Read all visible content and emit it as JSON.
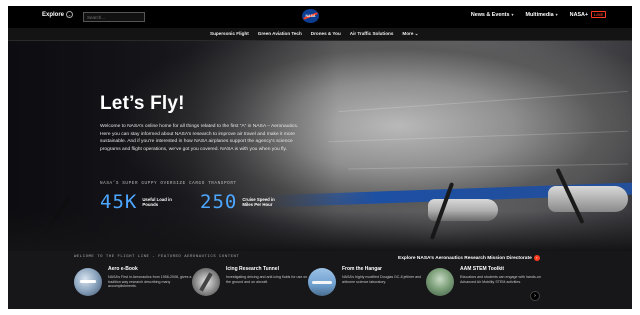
{
  "topnav": {
    "explore_label": "Explore",
    "search_placeholder": "Search...",
    "logo_text": "NASA",
    "right_items": [
      {
        "label": "News & Events",
        "has_caret": true
      },
      {
        "label": "Multimedia",
        "has_caret": true
      },
      {
        "label": "NASA+",
        "badge": "LIVE"
      }
    ]
  },
  "subnav": {
    "items": [
      "Supersonic Flight",
      "Green Aviation Tech",
      "Drones & You",
      "Air Traffic Solutions",
      "More"
    ]
  },
  "hero": {
    "title": "Let’s Fly!",
    "intro": "Welcome to NASA’s online home for all things related to the first “A” in NASA – Aeronautics. Here you can stay informed about NASA’s research to improve air travel and make it more sustainable. And if you’re interested in how NASA airplanes support the agency’s science programs and flight operations, we’ve got you covered. NASA is with you when you fly.",
    "eyebrow": "NASA’S SUPER GUPPY OVERSIZE CARGO TRANSPORT",
    "stats": [
      {
        "value": "45K",
        "label": "Useful Load in Pounds"
      },
      {
        "value": "250",
        "label": "Cruise Speed in Miles Per Hour"
      }
    ]
  },
  "bottom": {
    "eyebrow": "WELCOME TO THE FLIGHT LINE – FEATURED AERONAUTICS CONTENT",
    "link_label": "Explore NASA’s Aeronautics Research Mission Directorate",
    "cards": [
      {
        "title": "Aero e-Book",
        "desc": "NASA’s First in Aeronautics from 1958-2008, gives a tradition way research describing many accomplishments."
      },
      {
        "title": "Icing Research Tunnel",
        "desc": "Investigating deicing and anti-icing fluids for use on the ground and on aircraft."
      },
      {
        "title": "From the Hangar",
        "desc": "NASA’s highly modified Douglas DC-8 jetliner and airborne science laboratory."
      },
      {
        "title": "AAM STEM Toolkit",
        "desc": "Educators and students can engage with hands-on Advanced Air Mobility STEM activities."
      }
    ]
  },
  "colors": {
    "accent_blue": "#4da6ff",
    "nasa_red": "#fc3d21",
    "nasa_blue": "#0b3d91"
  }
}
